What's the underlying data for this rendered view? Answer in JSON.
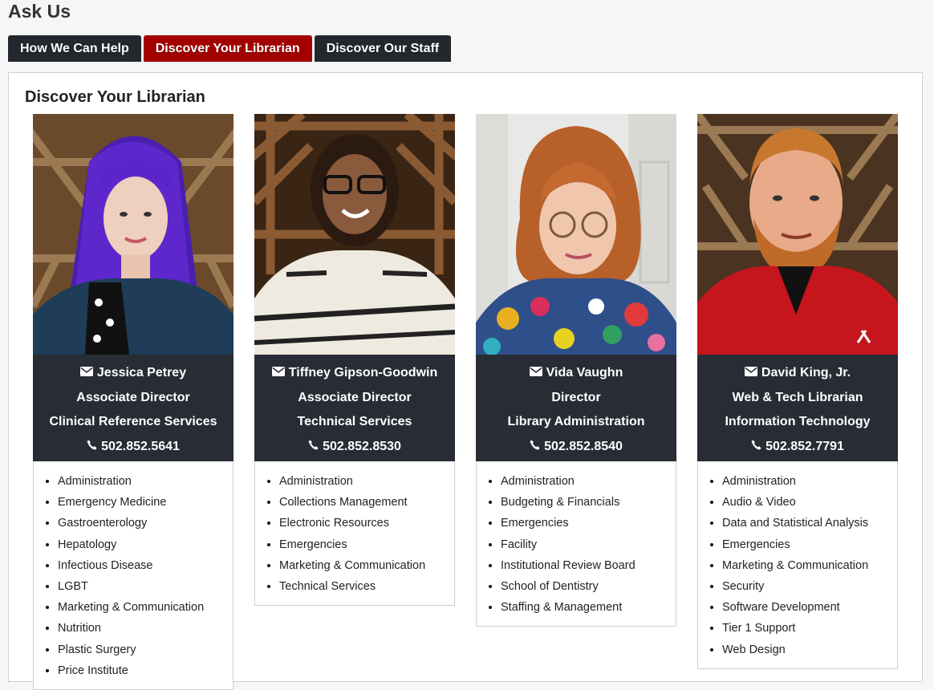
{
  "page": {
    "title": "Ask Us"
  },
  "tabs": [
    {
      "label": "How We Can Help",
      "active": false
    },
    {
      "label": "Discover Your Librarian",
      "active": true
    },
    {
      "label": "Discover Our Staff",
      "active": false
    }
  ],
  "section": {
    "title": "Discover Your Librarian"
  },
  "colors": {
    "tab_bg": "#23272e",
    "tab_active": "#a30000",
    "card_info_bg": "#282c34"
  },
  "librarians": [
    {
      "name": "Jessica Petrey",
      "title": "Associate Director",
      "department": "Clinical Reference Services",
      "phone": "502.852.5641",
      "topics": [
        "Administration",
        "Emergency Medicine",
        "Gastroenterology",
        "Hepatology",
        "Infectious Disease",
        "LGBT",
        "Marketing & Communication",
        "Nutrition",
        "Plastic Surgery",
        "Price Institute"
      ]
    },
    {
      "name": "Tiffney Gipson-Goodwin",
      "title": "Associate Director",
      "department": "Technical Services",
      "phone": "502.852.8530",
      "topics": [
        "Administration",
        "Collections Management",
        "Electronic Resources",
        "Emergencies",
        "Marketing & Communication",
        "Technical Services"
      ]
    },
    {
      "name": "Vida Vaughn",
      "title": "Director",
      "department": "Library Administration",
      "phone": "502.852.8540",
      "topics": [
        "Administration",
        "Budgeting & Financials",
        "Emergencies",
        "Facility",
        "Institutional Review Board",
        "School of Dentistry",
        "Staffing & Management"
      ]
    },
    {
      "name": "David King, Jr.",
      "title": "Web & Tech Librarian",
      "department": "Information Technology",
      "phone": "502.852.7791",
      "topics": [
        "Administration",
        "Audio & Video",
        "Data and Statistical Analysis",
        "Emergencies",
        "Marketing & Communication",
        "Security",
        "Software Development",
        "Tier 1 Support",
        "Web Design"
      ]
    }
  ]
}
